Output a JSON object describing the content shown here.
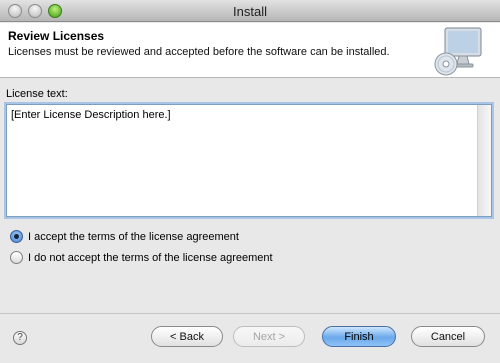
{
  "window": {
    "title": "Install"
  },
  "header": {
    "title": "Review Licenses",
    "description": "Licenses must be reviewed and accepted before the software can be installed.",
    "icon": "computer-cd-icon"
  },
  "license": {
    "label": "License text:",
    "text": "[Enter License Description here.]"
  },
  "options": {
    "accept_label": "I accept the terms of the license agreement",
    "decline_label": "I do not accept the terms of the license agreement",
    "selected": "accept"
  },
  "footer": {
    "help_icon": "help-icon",
    "help_glyph": "?",
    "back_label": "< Back",
    "next_label": "Next >",
    "finish_label": "Finish",
    "cancel_label": "Cancel"
  }
}
